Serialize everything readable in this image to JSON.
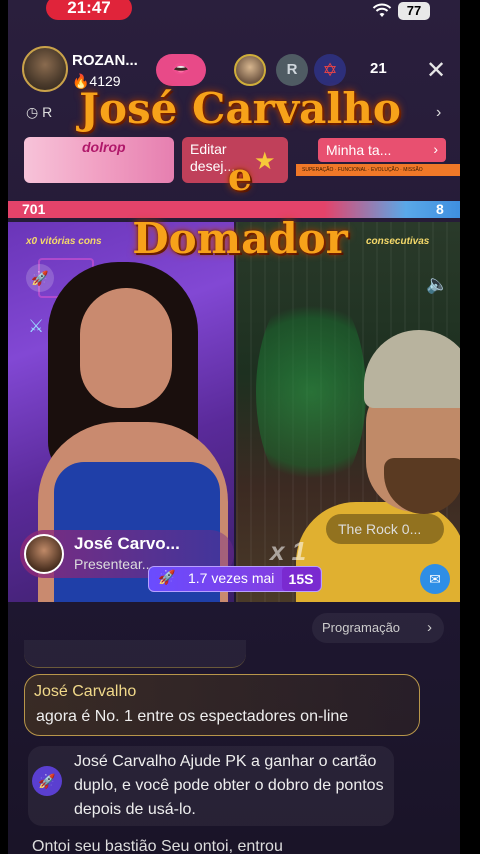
{
  "status_bar": {
    "time": "21:47",
    "battery": "77"
  },
  "host": {
    "name": "ROZAN...",
    "likes": "🔥4129"
  },
  "top_bar": {
    "viewer_count": "21",
    "viewer_initial": "R"
  },
  "sub_row": {
    "label": "R"
  },
  "banners": {
    "promo_text": "dolrop",
    "edit_wish_label": "Editar desej...",
    "my_task_label": "Minha ta...",
    "task_strip_text": "SUPERAÇÃO · FUNCIONAL · EVOLUÇÃO · MISSÃO"
  },
  "pk": {
    "left_score": "701",
    "right_score": "8",
    "wins_left": "x0 vitórias cons",
    "wins_right": "consecutivas"
  },
  "guest": {
    "name": "The Rock 0..."
  },
  "gift": {
    "sender_name": "José Carvo...",
    "action": "Presentear...",
    "multiplier": "x 1"
  },
  "boost": {
    "text": "1.7 vezes mai",
    "timer": "15S"
  },
  "schedule": {
    "label": "Programação"
  },
  "chat": {
    "gold_name": "José Carvalho",
    "gold_message": "agora é No. 1 entre os espectadores on-line",
    "system_message": "José Carvalho Ajude PK a ganhar o cartão duplo, e você pode obter o dobro de pontos depois de usá-lo.",
    "bottom_message": "Ontoi seu bastião Seu ontoi, entrou"
  },
  "overlay": {
    "line1": "José Carvalho",
    "line2": "e",
    "line3": "Domador"
  },
  "colors": {
    "time_pill": "#e0243a",
    "pk_red": "#e4436a",
    "pk_blue": "#3f8fe0",
    "overlay_fire": "#f7a21a",
    "gold_border": "#b8964a"
  }
}
